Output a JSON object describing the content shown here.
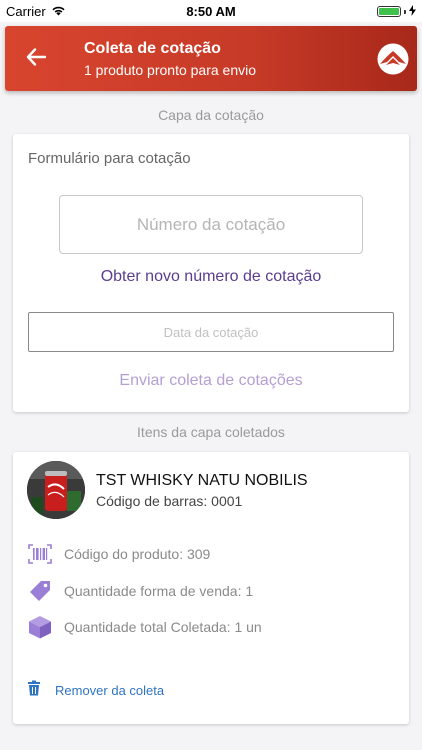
{
  "status_bar": {
    "carrier": "Carrier",
    "time": "8:50 AM"
  },
  "header": {
    "title": "Coleta de cotação",
    "subtitle": "1 produto pronto para envio"
  },
  "quote_header": {
    "section_label": "Capa da cotação",
    "form_title": "Formulário para cotação",
    "quote_number_placeholder": "Número da cotação",
    "new_number_link": "Obter novo número de cotação",
    "date_placeholder": "Data da cotação",
    "send_link": "Enviar coleta de cotações"
  },
  "collected_items": {
    "section_label": "Itens da capa coletados",
    "item": {
      "name": "TST WHISKY NATU NOBILIS",
      "barcode": "Código de barras: 0001",
      "product_code": "Código do produto: 309",
      "sale_quantity": "Quantidade forma de venda: 1",
      "total_quantity": "Quantidade total Coletada: 1 un",
      "remove_label": "Remover da coleta"
    }
  },
  "colors": {
    "header_gradient_start": "#d8452f",
    "header_gradient_end": "#a8281a",
    "link_purple": "#5b3d8d",
    "link_purple_disabled": "#b59fd2",
    "icon_purple": "#9b7fd6",
    "remove_blue": "#2f74c0"
  },
  "icons": {
    "back": "arrow-left-icon",
    "brand": "brand-logo-icon",
    "wifi": "wifi-icon",
    "battery": "battery-icon",
    "barcode": "barcode-icon",
    "tag": "tag-icon",
    "box": "box-icon",
    "trash": "trash-icon"
  }
}
